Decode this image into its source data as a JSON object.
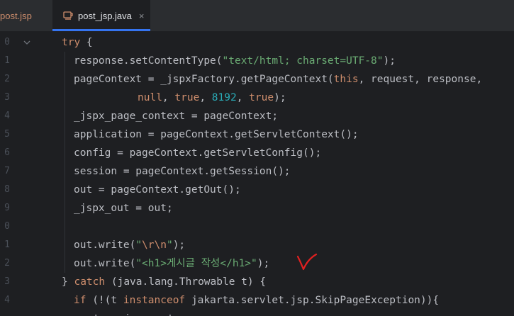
{
  "tabs": [
    {
      "label": "post.jsp",
      "active": false
    },
    {
      "label": "post_jsp.java",
      "active": true
    }
  ],
  "close_glyph": "×",
  "line_numbers": [
    "0",
    "1",
    "2",
    "3",
    "4",
    "5",
    "6",
    "7",
    "8",
    "9",
    "0",
    "1",
    "2",
    "3",
    "4"
  ],
  "code_lines": [
    [
      {
        "t": "try",
        "c": "kw"
      },
      {
        "t": " {",
        "c": ""
      }
    ],
    [
      {
        "t": "response.setContentType(",
        "c": ""
      },
      {
        "t": "\"text/html; charset=UTF-8\"",
        "c": "str"
      },
      {
        "t": ");",
        "c": ""
      }
    ],
    [
      {
        "t": "pageContext = _jspxFactory.getPageContext(",
        "c": ""
      },
      {
        "t": "this",
        "c": "kw"
      },
      {
        "t": ", request, response,",
        "c": ""
      }
    ],
    [
      {
        "t": "null",
        "c": "kw"
      },
      {
        "t": ", ",
        "c": ""
      },
      {
        "t": "true",
        "c": "kw"
      },
      {
        "t": ", ",
        "c": ""
      },
      {
        "t": "8192",
        "c": "num"
      },
      {
        "t": ", ",
        "c": ""
      },
      {
        "t": "true",
        "c": "kw"
      },
      {
        "t": ");",
        "c": ""
      }
    ],
    [
      {
        "t": "_jspx_page_context = pageContext;",
        "c": ""
      }
    ],
    [
      {
        "t": "application = pageContext.getServletContext();",
        "c": ""
      }
    ],
    [
      {
        "t": "config = pageContext.getServletConfig();",
        "c": ""
      }
    ],
    [
      {
        "t": "session = pageContext.getSession();",
        "c": ""
      }
    ],
    [
      {
        "t": "out = pageContext.getOut();",
        "c": ""
      }
    ],
    [
      {
        "t": "_jspx_out = out;",
        "c": ""
      }
    ],
    [],
    [
      {
        "t": "out.write(",
        "c": ""
      },
      {
        "t": "\"",
        "c": "str"
      },
      {
        "t": "\\r\\n",
        "c": "esc"
      },
      {
        "t": "\"",
        "c": "str"
      },
      {
        "t": ");",
        "c": ""
      }
    ],
    [
      {
        "t": "out.write(",
        "c": ""
      },
      {
        "t": "\"<h1>게시글 작성</h1>\"",
        "c": "str"
      },
      {
        "t": ");",
        "c": ""
      }
    ],
    [
      {
        "t": "} ",
        "c": ""
      },
      {
        "t": "catch",
        "c": "kw"
      },
      {
        "t": " (java.lang.Throwable t) {",
        "c": ""
      }
    ],
    [
      {
        "t": "if",
        "c": "kw"
      },
      {
        "t": " (!(t ",
        "c": ""
      },
      {
        "t": "instanceof",
        "c": "kw"
      },
      {
        "t": " jakarta.servlet.jsp.SkipPageException)){",
        "c": ""
      }
    ],
    [
      {
        "t": "out = _jspx_out;",
        "c": ""
      }
    ]
  ],
  "colors": {
    "background": "#1e1f22",
    "tabbar": "#2b2d30",
    "active_tab_underline": "#3574f0",
    "keyword": "#cf8e6d",
    "string": "#6aab73",
    "number": "#2aacb8",
    "default_text": "#bcbec4",
    "annotation_check": "#e02020"
  },
  "icons": {
    "file_icon": "java-file-icon",
    "fold": "chevron-down-icon",
    "annotation": "red-checkmark-icon"
  }
}
